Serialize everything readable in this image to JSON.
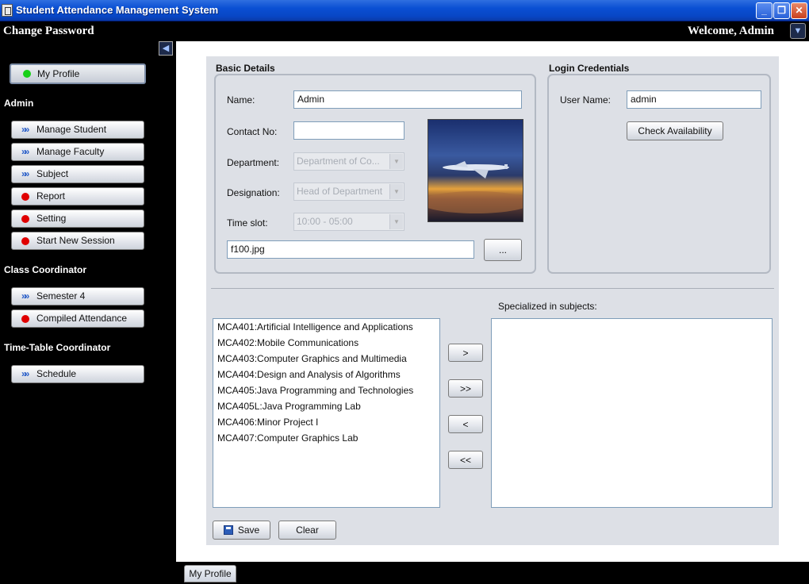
{
  "window": {
    "title": "Student Attendance Management System"
  },
  "topbar": {
    "left_title": "Change Password",
    "welcome": "Welcome, Admin"
  },
  "sidebar": {
    "profile_label": "My Profile",
    "sections": {
      "admin": {
        "heading": "Admin",
        "items": [
          "Manage Student",
          "Manage Faculty",
          "Subject",
          "Report",
          "Setting",
          "Start New Session"
        ]
      },
      "class_coordinator": {
        "heading": "Class Coordinator",
        "items": [
          "Semester 4",
          "Compiled Attendance"
        ]
      },
      "timetable_coordinator": {
        "heading": "Time-Table Coordinator",
        "items": [
          "Schedule"
        ]
      }
    }
  },
  "basic_details": {
    "heading": "Basic Details",
    "name_label": "Name:",
    "name_value": "Admin",
    "contact_label": "Contact No:",
    "contact_value": "",
    "department_label": "Department:",
    "department_value": "Department of Co...",
    "designation_label": "Designation:",
    "designation_value": "Head of Department",
    "timeslot_label": "Time slot:",
    "timeslot_value": "10:00 - 05:00",
    "photo_file": "f100.jpg",
    "browse_label": "..."
  },
  "login": {
    "heading": "Login Credentials",
    "username_label": "User Name:",
    "username_value": "admin",
    "check_label": "Check Availability"
  },
  "subjects": {
    "specialized_label": "Specialized in subjects:",
    "available": [
      "MCA401:Artificial Intelligence and Applications",
      "MCA402:Mobile Communications",
      "MCA403:Computer Graphics and Multimedia",
      "MCA404:Design and Analysis of Algorithms",
      "MCA405:Java Programming and Technologies",
      "MCA405L:Java Programming Lab",
      "MCA406:Minor Project I",
      "MCA407:Computer Graphics Lab"
    ],
    "specialized": [],
    "move_one": ">",
    "move_all": ">>",
    "remove_one": "<",
    "remove_all": "<<"
  },
  "actions": {
    "save": "Save",
    "clear": "Clear"
  },
  "bottom_tab": {
    "label": "My Profile"
  },
  "colors": {
    "titlebar": "#0a4fd3",
    "panel": "#dde0e6",
    "status_red": "#e00000",
    "status_green": "#18d018"
  }
}
